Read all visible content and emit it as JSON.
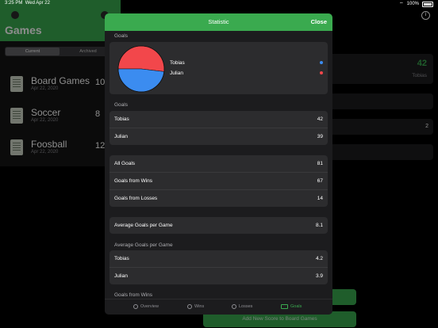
{
  "status": {
    "time": "3:25 PM",
    "date": "Wed Apr 22",
    "battery": "100%"
  },
  "left": {
    "title": "Games",
    "segments": [
      "Current",
      "Archived"
    ],
    "games": [
      {
        "name": "Board Games",
        "date": "Apr 22, 2020",
        "score": "10"
      },
      {
        "name": "Soccer",
        "date": "Apr 22, 2020",
        "score": "8"
      },
      {
        "name": "Foosball",
        "date": "Apr 22, 2020",
        "score": "12"
      }
    ]
  },
  "right_bg": {
    "leader_score": "42",
    "leader_name": "Tobias",
    "row2_value": "2",
    "add_button": "Add New Score to Board Games"
  },
  "modal": {
    "title": "Statistic",
    "close": "Close",
    "goals_header": "Goals",
    "pie": {
      "slices": [
        {
          "name": "Tobias",
          "value": 42,
          "color": "#f2474b"
        },
        {
          "name": "Julian",
          "value": 39,
          "color": "#3b8cf0"
        }
      ],
      "legend": [
        {
          "name": "Tobias",
          "dot": "#3b8cf0"
        },
        {
          "name": "Julian",
          "dot": "#f2474b"
        }
      ]
    },
    "goals_section": "Goals",
    "goals": [
      {
        "label": "Tobias",
        "value": "42"
      },
      {
        "label": "Julian",
        "value": "39"
      }
    ],
    "totals": [
      {
        "label": "All Goals",
        "value": "81"
      },
      {
        "label": "Goals from Wins",
        "value": "67"
      },
      {
        "label": "Goals from Losses",
        "value": "14"
      }
    ],
    "avg": {
      "label": "Average Goals per Game",
      "value": "8.1"
    },
    "avg_section": "Average Goals per Game",
    "avg_players": [
      {
        "label": "Tobias",
        "value": "4.2"
      },
      {
        "label": "Julian",
        "value": "3.9"
      }
    ],
    "wins_section": "Goals from Wins",
    "tabs": [
      "Overview",
      "Wins",
      "Losses",
      "Goals"
    ],
    "active_tab": "Goals"
  },
  "accent": "#3aaa4f"
}
